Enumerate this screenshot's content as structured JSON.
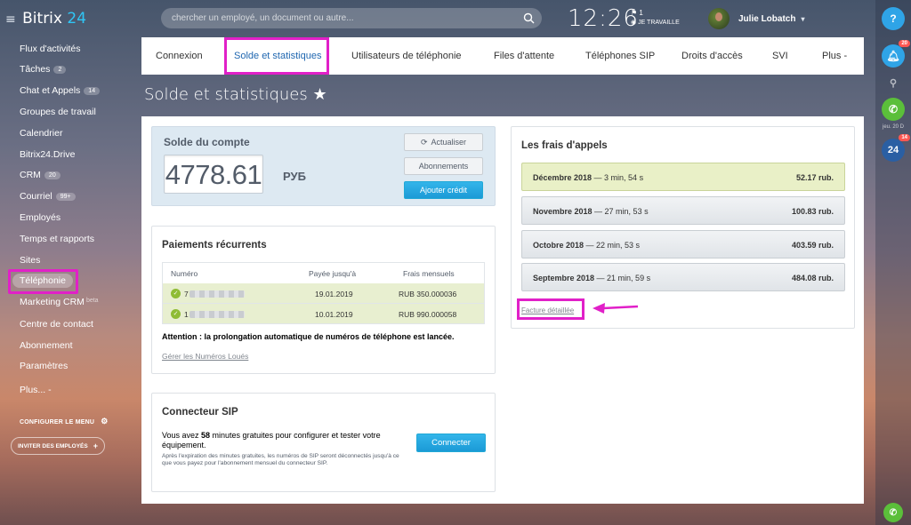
{
  "header": {
    "brand_name": "Bitrix",
    "brand_num": "24",
    "search_placeholder": "chercher un employé, un document ou autre...",
    "clock": "12:26",
    "clock_flag": "1",
    "work_status": "JE TRAVAILLE",
    "user_name": "Julie Lobatch"
  },
  "right_rail": {
    "help": "?",
    "notifications_count": "20",
    "date_label": "jeu. 20 D",
    "b24_label": "24",
    "b24_count": "14"
  },
  "sidebar": {
    "items": [
      {
        "label": "Flux d'activités"
      },
      {
        "label": "Tâches",
        "count": "2"
      },
      {
        "label": "Chat et Appels",
        "count": "14"
      },
      {
        "label": "Groupes de travail"
      },
      {
        "label": "Calendrier"
      },
      {
        "label": "Bitrix24.Drive"
      },
      {
        "label": "CRM",
        "count": "20"
      },
      {
        "label": "Courriel",
        "count": "99+"
      },
      {
        "label": "Employés"
      },
      {
        "label": "Temps et rapports"
      },
      {
        "label": "Sites"
      },
      {
        "label": "Téléphonie"
      },
      {
        "label": "Marketing CRM",
        "beta": "beta"
      },
      {
        "label": "Centre de contact"
      },
      {
        "label": "Abonnement"
      },
      {
        "label": "Paramètres"
      },
      {
        "label": "Plus... -"
      }
    ],
    "configure_label": "CONFIGURER LE MENU",
    "invite_label": "INVITER DES EMPLOYÉS"
  },
  "tabs": [
    {
      "label": "Connexion"
    },
    {
      "label": "Solde et statistiques"
    },
    {
      "label": "Utilisateurs de téléphonie"
    },
    {
      "label": "Files d'attente"
    },
    {
      "label": "Téléphones SIP"
    },
    {
      "label": "Droits d'accès"
    },
    {
      "label": "SVI"
    },
    {
      "label": "Plus -"
    }
  ],
  "page_title": "Solde et statistiques ★",
  "balance": {
    "label": "Solde du compte",
    "amount": "4778.61",
    "currency": "РУБ",
    "refresh_label": "Actualiser",
    "subscriptions_label": "Abonnements",
    "add_credit_label": "Ajouter crédit"
  },
  "recurring": {
    "title": "Paiements récurrents",
    "columns": [
      "Numéro",
      "Payée jusqu'à",
      "Frais mensuels"
    ],
    "rows": [
      {
        "number": "7",
        "paid_until": "19.01.2019",
        "fee": "RUB 350.000036"
      },
      {
        "number": "1",
        "paid_until": "10.01.2019",
        "fee": "RUB 990.000058"
      }
    ],
    "warning": "Attention : la prolongation automatique de numéros de téléphone est lancée.",
    "manage_link": "Gérer les Numéros Loués"
  },
  "sip": {
    "title": "Connecteur SIP",
    "text_before": "Vous avez ",
    "minutes": "58",
    "text_after": " minutes gratuites pour configurer et tester votre équipement.",
    "note": "Après l'expiration des minutes gratuites, les numéros de SIP seront déconnectés jusqu'à ce que vous payez pour l'abonnement mensuel du connecteur SIP.",
    "connect_label": "Connecter"
  },
  "fees": {
    "title": "Les frais d'appels",
    "months": [
      {
        "month": "Décembre 2018",
        "duration": " — 3 min, 54 s",
        "amount": "52.17 rub."
      },
      {
        "month": "Novembre 2018",
        "duration": " — 27 min, 53 s",
        "amount": "100.83 rub."
      },
      {
        "month": "Octobre 2018",
        "duration": " — 22 min, 53 s",
        "amount": "403.59 rub."
      },
      {
        "month": "Septembre 2018",
        "duration": " — 21 min, 59 s",
        "amount": "484.08 rub."
      }
    ],
    "detail_link": "Facture détaillée"
  },
  "colors": {
    "accent_blue": "#2fc6f6",
    "highlight": "#e120c8",
    "current_month": "#e9f0c7"
  }
}
